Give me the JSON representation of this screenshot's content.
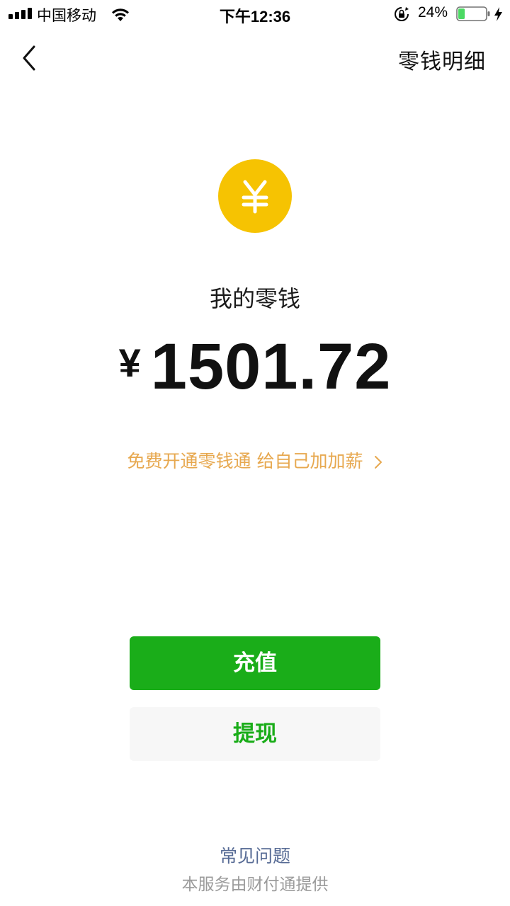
{
  "status_bar": {
    "carrier": "中国移动",
    "time": "下午12:36",
    "battery_percent": "24%",
    "battery_level": 0.24,
    "battery_color": "#4cd964",
    "icons": [
      "signal-icon",
      "wifi-icon",
      "rotation-lock-icon",
      "battery-icon",
      "charging-icon"
    ]
  },
  "nav": {
    "back_icon": "chevron-left-icon",
    "action_label": "零钱明细"
  },
  "balance": {
    "icon": "yuan-coin-icon",
    "coin_color": "#f6c302",
    "label": "我的零钱",
    "currency_symbol": "¥",
    "amount": "1501.72"
  },
  "promo": {
    "text": "免费开通零钱通 给自己加加薪",
    "icon": "chevron-right-icon",
    "color": "#e7a84f"
  },
  "actions": {
    "recharge_label": "充值",
    "withdraw_label": "提现",
    "primary_color": "#1aad19"
  },
  "footer": {
    "faq_label": "常见问题",
    "provider_note": "本服务由财付通提供"
  }
}
